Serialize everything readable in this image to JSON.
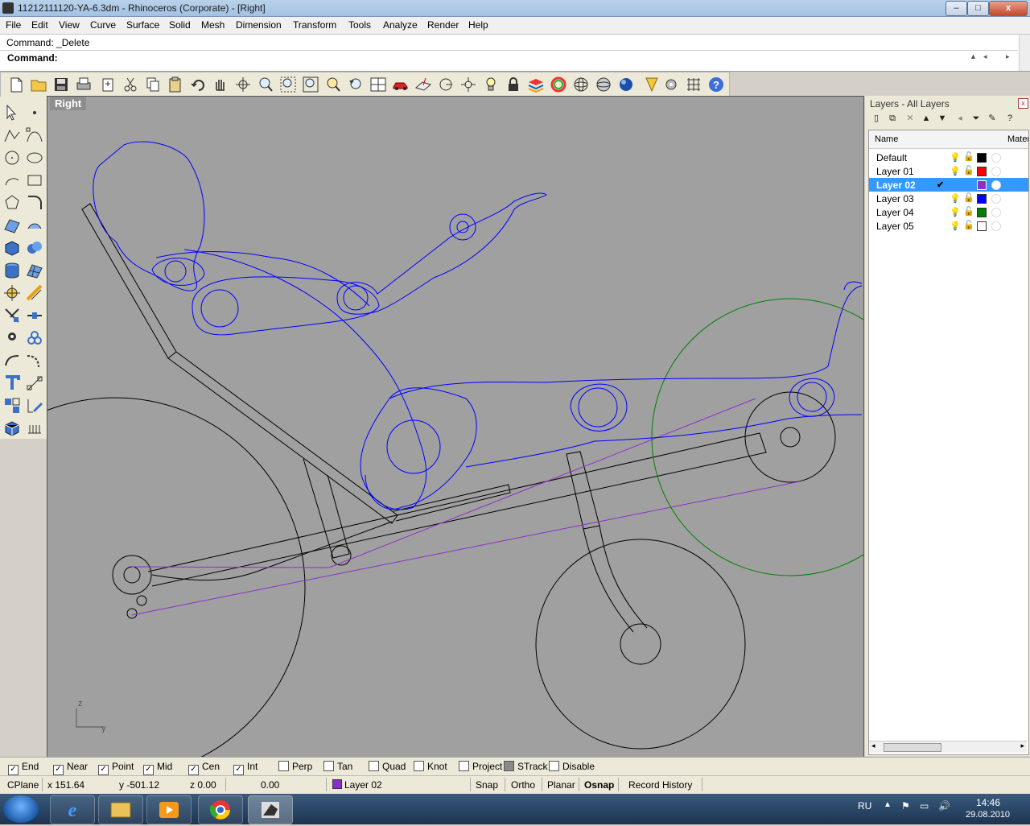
{
  "window": {
    "title": "11212111120-YA-6.3dm - Rhinoceros (Corporate) - [Right]",
    "minimize": "–",
    "maximize": "□",
    "close": "x"
  },
  "menubar": [
    "File",
    "Edit",
    "View",
    "Curve",
    "Surface",
    "Solid",
    "Mesh",
    "Dimension",
    "Transform",
    "Tools",
    "Analyze",
    "Render",
    "Help"
  ],
  "command": {
    "history": "Command: _Delete",
    "prompt": "Command:",
    "value": ""
  },
  "toolbar_icons": [
    "new-file-icon",
    "open-folder-icon",
    "save-icon",
    "print-icon",
    "import-icon",
    "cut-icon",
    "copy-icon",
    "paste-icon",
    "undo-icon",
    "pan-hand-icon",
    "rotate-view-icon",
    "zoom-icon",
    "zoom-window-icon",
    "zoom-extents-icon",
    "zoom-selected-icon",
    "undo-view-icon",
    "four-viewports-icon",
    "car-icon",
    "cplane-icon",
    "cplane-origin-icon",
    "osnap-icon",
    "lightbulb-icon",
    "lock-icon",
    "layer-icon",
    "color-wheel-icon",
    "render-wireframe-icon",
    "render-ghosted-icon",
    "render-sphere-icon",
    "light-icon",
    "options-icon",
    "grid-settings-icon",
    "help-icon"
  ],
  "viewport": {
    "label": "Right",
    "axis_z": "z",
    "axis_y": "y"
  },
  "layers": {
    "header": "Layers - All Layers",
    "col_name": "Name",
    "col_mat": "Mater",
    "rows": [
      {
        "name": "Default",
        "color": "#000000",
        "current": false
      },
      {
        "name": "Layer 01",
        "color": "#ff0000",
        "current": false
      },
      {
        "name": "Layer 02",
        "color": "#8b2fc9",
        "current": true
      },
      {
        "name": "Layer 03",
        "color": "#0000ff",
        "current": false
      },
      {
        "name": "Layer 04",
        "color": "#008000",
        "current": false
      },
      {
        "name": "Layer 05",
        "color": "#ffffff",
        "current": false
      }
    ]
  },
  "osnap": [
    {
      "label": "End",
      "checked": true
    },
    {
      "label": "Near",
      "checked": true
    },
    {
      "label": "Point",
      "checked": true
    },
    {
      "label": "Mid",
      "checked": true
    },
    {
      "label": "Cen",
      "checked": true
    },
    {
      "label": "Int",
      "checked": true
    },
    {
      "label": "Perp",
      "checked": false
    },
    {
      "label": "Tan",
      "checked": false
    },
    {
      "label": "Quad",
      "checked": false
    },
    {
      "label": "Knot",
      "checked": false
    },
    {
      "label": "Project",
      "checked": false
    },
    {
      "label": "STrack",
      "checked": false
    },
    {
      "label": "Disable",
      "checked": false
    }
  ],
  "status": {
    "cplane": "CPlane",
    "x": "x 151.64",
    "y": "y -501.12",
    "z": "z 0.00",
    "extra": "0.00",
    "layer": "Layer 02",
    "layer_color": "#8b2fc9",
    "snap": "Snap",
    "ortho": "Ortho",
    "planar": "Planar",
    "osnap": "Osnap",
    "record": "Record History"
  },
  "taskbar": {
    "lang": "RU",
    "time": "14:46",
    "date": "29.08.2010",
    "apps": [
      "internet-explorer-icon",
      "file-explorer-icon",
      "media-player-icon",
      "chrome-icon",
      "rhino-icon"
    ]
  },
  "colors": {
    "curve_black": "#000000",
    "curve_blue": "#0000ff",
    "curve_purple": "#8b2fc9",
    "curve_green": "#008000",
    "viewport_bg": "#a0a0a0"
  }
}
